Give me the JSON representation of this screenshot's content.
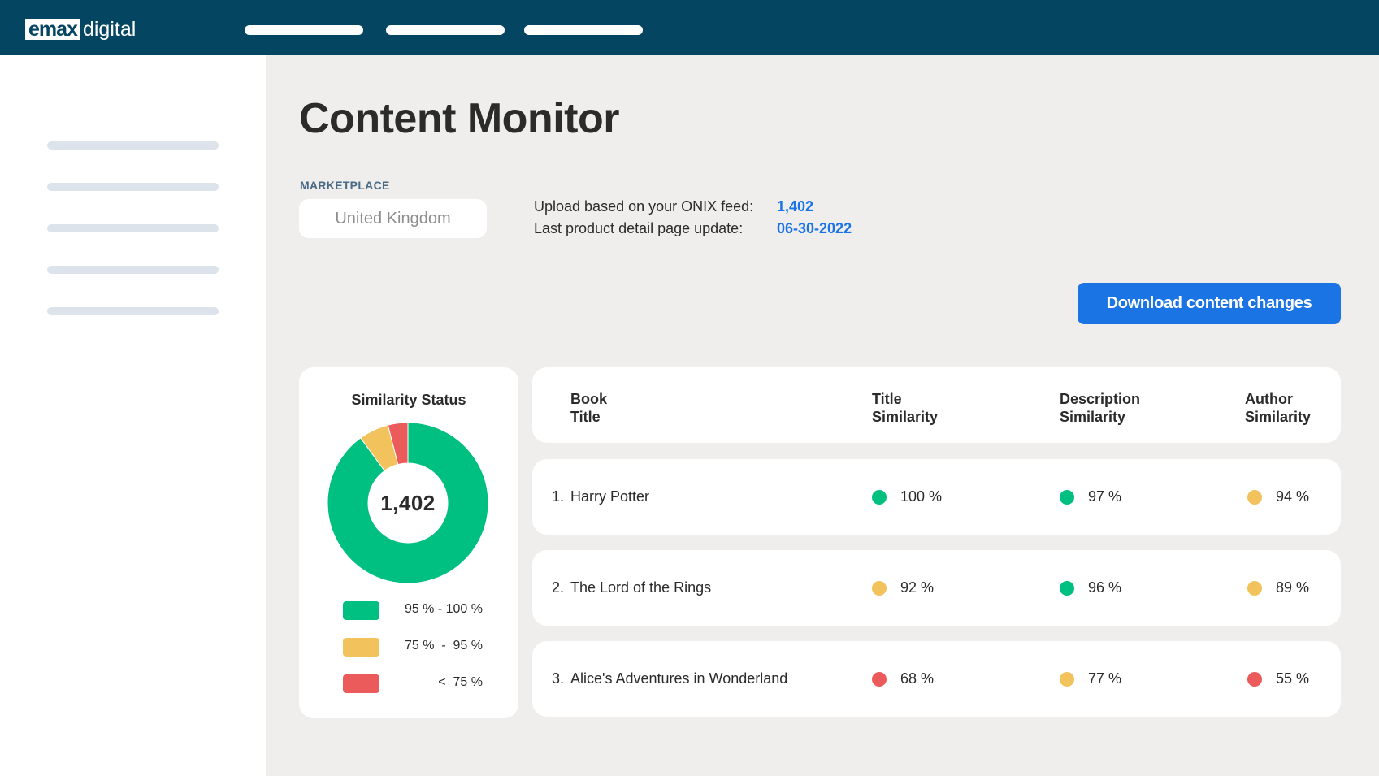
{
  "brand": {
    "logo_box": "emax",
    "logo_word": "digital"
  },
  "colors": {
    "green": "#00c081",
    "yellow": "#f2c25c",
    "red": "#ec5b5b",
    "accent": "#1b74e4",
    "topbar": "#044662"
  },
  "page": {
    "title": "Content Monitor"
  },
  "marketplace": {
    "label": "MARKETPLACE",
    "value": "United Kingdom"
  },
  "info": {
    "upload_label": "Upload based on your ONIX feed:",
    "upload_value": "1,402",
    "update_label": "Last product detail page update:",
    "update_value": "06-30-2022"
  },
  "download_button": "Download content changes",
  "status": {
    "title": "Similarity Status",
    "total": "1,402",
    "chart_data": {
      "type": "pie",
      "categories": [
        "95 % - 100 %",
        "75 %  -  95 %",
        "<  75 %"
      ],
      "values": [
        90,
        6,
        4
      ],
      "colors": [
        "#00c081",
        "#f2c25c",
        "#ec5b5b"
      ]
    },
    "legend": [
      "95 % - 100 %",
      "75 %  -  95 %",
      "<  75 %"
    ]
  },
  "table": {
    "headers": {
      "book": [
        "Book",
        "Title"
      ],
      "title_sim": [
        "Title",
        "Similarity"
      ],
      "desc_sim": [
        "Description",
        "Similarity"
      ],
      "author_sim": [
        "Author",
        "Similarity"
      ]
    },
    "rows": [
      {
        "num": "1.",
        "title": "Harry Potter",
        "title_sim": "100 %",
        "title_color": "green",
        "desc_sim": "97 %",
        "desc_color": "green",
        "author_sim": "94 %",
        "author_color": "yellow"
      },
      {
        "num": "2.",
        "title": "The Lord of the Rings",
        "title_sim": "92 %",
        "title_color": "yellow",
        "desc_sim": "96 %",
        "desc_color": "green",
        "author_sim": "89 %",
        "author_color": "yellow"
      },
      {
        "num": "3.",
        "title": "Alice's Adventures in Wonderland",
        "title_sim": "68 %",
        "title_color": "red",
        "desc_sim": "77 %",
        "desc_color": "yellow",
        "author_sim": "55 %",
        "author_color": "red"
      }
    ]
  }
}
